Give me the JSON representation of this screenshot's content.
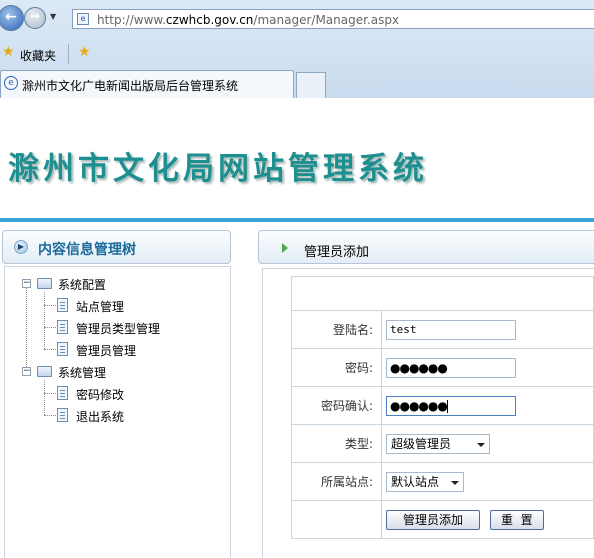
{
  "browser": {
    "url_prefix": "http://www.",
    "url_domain": "czwhcb.gov.cn",
    "url_path": "/manager/Manager.aspx",
    "favorites_label": "收藏夹",
    "tab_title": "滁州市文化广电新闻出版局后台管理系统"
  },
  "header": {
    "title": "滁州市文化局网站管理系统"
  },
  "sidebar": {
    "title": "内容信息管理树",
    "tree": [
      {
        "label": "系统配置",
        "children": [
          "站点管理",
          "管理员类型管理",
          "管理员管理"
        ]
      },
      {
        "label": "系统管理",
        "children": [
          "密码修改",
          "退出系统"
        ]
      }
    ]
  },
  "main": {
    "title": "管理员添加",
    "form": {
      "login_label": "登陆名:",
      "login_value": "test",
      "password_label": "密码:",
      "password_value": "●●●●●●",
      "confirm_label": "密码确认:",
      "confirm_value": "●●●●●●",
      "type_label": "类型:",
      "type_value": "超级管理员",
      "site_label": "所属站点:",
      "site_value": "默认站点",
      "submit_label": "管理员添加",
      "reset_label": "重  置"
    }
  },
  "colors": {
    "banner_title": "#1e8f8f",
    "header_line": "#3aa6d8",
    "sidebar_title": "#1a6a9a"
  }
}
